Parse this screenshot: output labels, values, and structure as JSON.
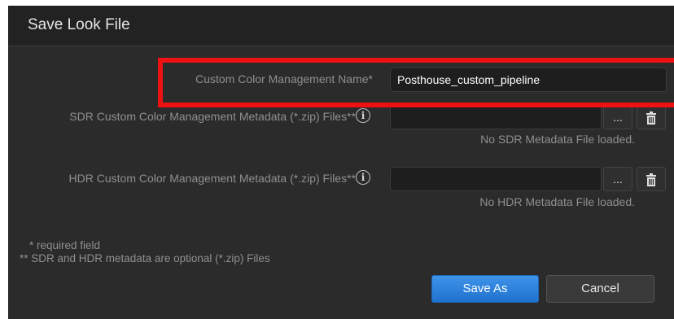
{
  "dialog": {
    "title": "Save Look File",
    "name_label": "Custom Color Management Name*",
    "name_value": "Posthouse_custom_pipeline",
    "sdr_label": "SDR Custom Color Management Metadata (*.zip) Files**",
    "sdr_browse": "...",
    "sdr_status": "No SDR Metadata File loaded.",
    "hdr_label": "HDR Custom Color Management Metadata (*.zip) Files**",
    "hdr_browse": "...",
    "hdr_status": "No HDR Metadata File loaded.",
    "note_required": "* required field",
    "note_optional": "** SDR and HDR metadata are optional (*.zip) Files",
    "save_label": "Save As",
    "cancel_label": "Cancel"
  },
  "icons": {
    "info": "info-icon",
    "delete": "trash-icon"
  },
  "colors": {
    "accent": "#2a82e4",
    "highlight": "#ee1111",
    "background": "#2b2b2b"
  }
}
